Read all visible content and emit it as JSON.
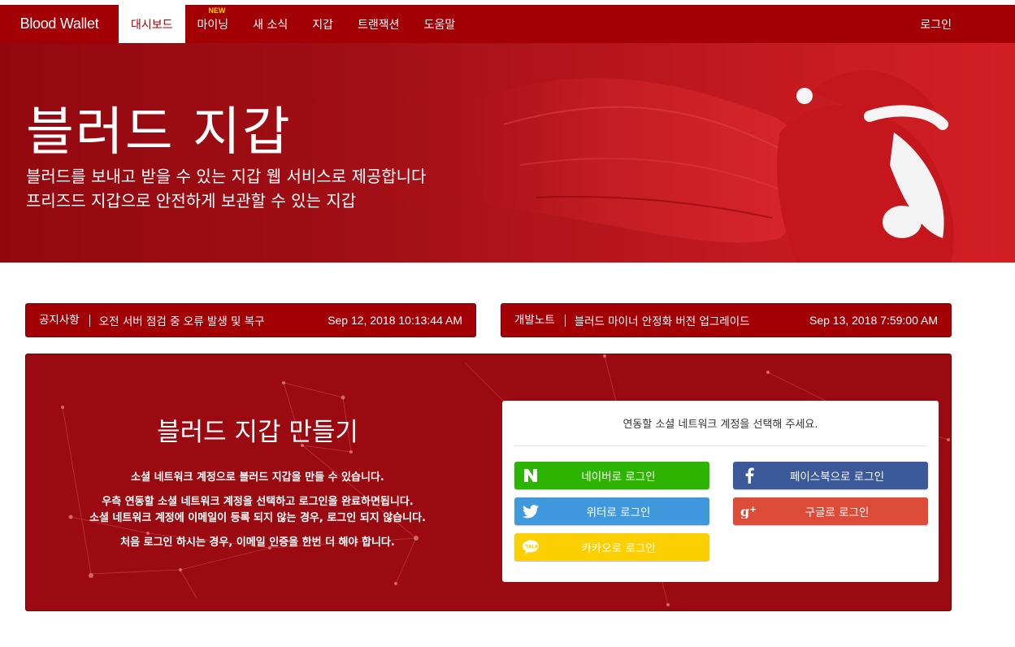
{
  "nav": {
    "brand": "Blood Wallet",
    "items": [
      {
        "label": "대시보드",
        "active": true
      },
      {
        "label": "마이닝",
        "badge": "NEW"
      },
      {
        "label": "새 소식"
      },
      {
        "label": "지갑"
      },
      {
        "label": "트랜잭션"
      },
      {
        "label": "도움말"
      }
    ],
    "login": "로그인"
  },
  "hero": {
    "title": "블러드 지갑",
    "subtitle_1": "블러드를 보내고 받을 수 있는 지갑 웹 서비스로 제공합니다",
    "subtitle_2": "프리즈드 지갑으로 안전하게 보관할 수 있는 지갑"
  },
  "notices": [
    {
      "category": "공지사항",
      "title": "오전 서버 점검 중 오류 발생 및 복구",
      "time": "Sep 12, 2018 10:13:44 AM"
    },
    {
      "category": "개발노트",
      "title": "블러드 마이너 안정화 버전 업그레이드",
      "time": "Sep 13, 2018 7:59:00 AM"
    }
  ],
  "create": {
    "title": "블러드 지갑 만들기",
    "text_1": "소셜 네트워크 계정으로 블러드 지갑을 만들 수 있습니다.",
    "text_2": "우측 연동할 소셜 네트워크 계정을 선택하고 로그인을 완료하면됩니다.",
    "text_3": "소셜 네트워크 계정에 이메일이 등록 되지 않는 경우, 로그인 되지 않습니다.",
    "text_4": "처음 로그인 하시는 경우, 이메일 인증을 한번 더 해야 합니다."
  },
  "login_card": {
    "prompt": "연동할 소셜 네트워크 계정을 선택해 주세요.",
    "buttons": {
      "naver": {
        "label": "네이버로 로그인",
        "icon": "naver-icon",
        "color": "#2db400"
      },
      "facebook": {
        "label": "페이스북으로 로그인",
        "icon": "facebook-icon",
        "color": "#3b5998"
      },
      "twitter": {
        "label": "위터로 로그인",
        "icon": "twitter-icon",
        "color": "#4099dc"
      },
      "google": {
        "label": "구글로 로그인",
        "icon": "google-plus-icon",
        "color": "#dd4b39"
      },
      "kakao": {
        "label": "카카오로 로그인",
        "icon": "kakao-icon",
        "color": "#fcd000"
      }
    }
  },
  "colors": {
    "brand_red": "#a30006",
    "panel_red": "#9a0a10"
  }
}
